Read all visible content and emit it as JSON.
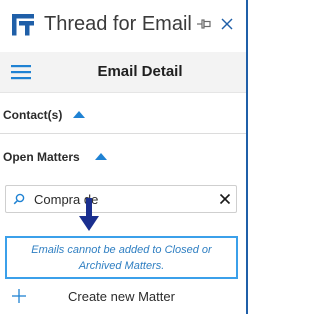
{
  "app": {
    "title": "Thread for Email",
    "logo_icon": "thread-logo-icon",
    "pin_icon": "pin-icon",
    "close_icon": "close-icon"
  },
  "header": {
    "menu_icon": "hamburger-icon",
    "title": "Email Detail"
  },
  "sections": {
    "contacts": {
      "label": "Contact(s)",
      "state_icon": "chevron-up-icon"
    },
    "open_matters": {
      "label": "Open Matters",
      "state_icon": "chevron-up-icon"
    }
  },
  "search": {
    "icon": "search-icon",
    "value": "Compra de",
    "clear_icon": "clear-icon"
  },
  "annotation": {
    "arrow_icon": "down-arrow-icon",
    "notice": "Emails cannot be added to Closed or Archived Matters."
  },
  "create": {
    "icon": "plus-icon",
    "label": "Create new Matter"
  },
  "colors": {
    "accent": "#2f7fc2",
    "notice_border": "#3ba0ea",
    "logo": "#1f5fa8",
    "caret": "#1f82d3"
  }
}
